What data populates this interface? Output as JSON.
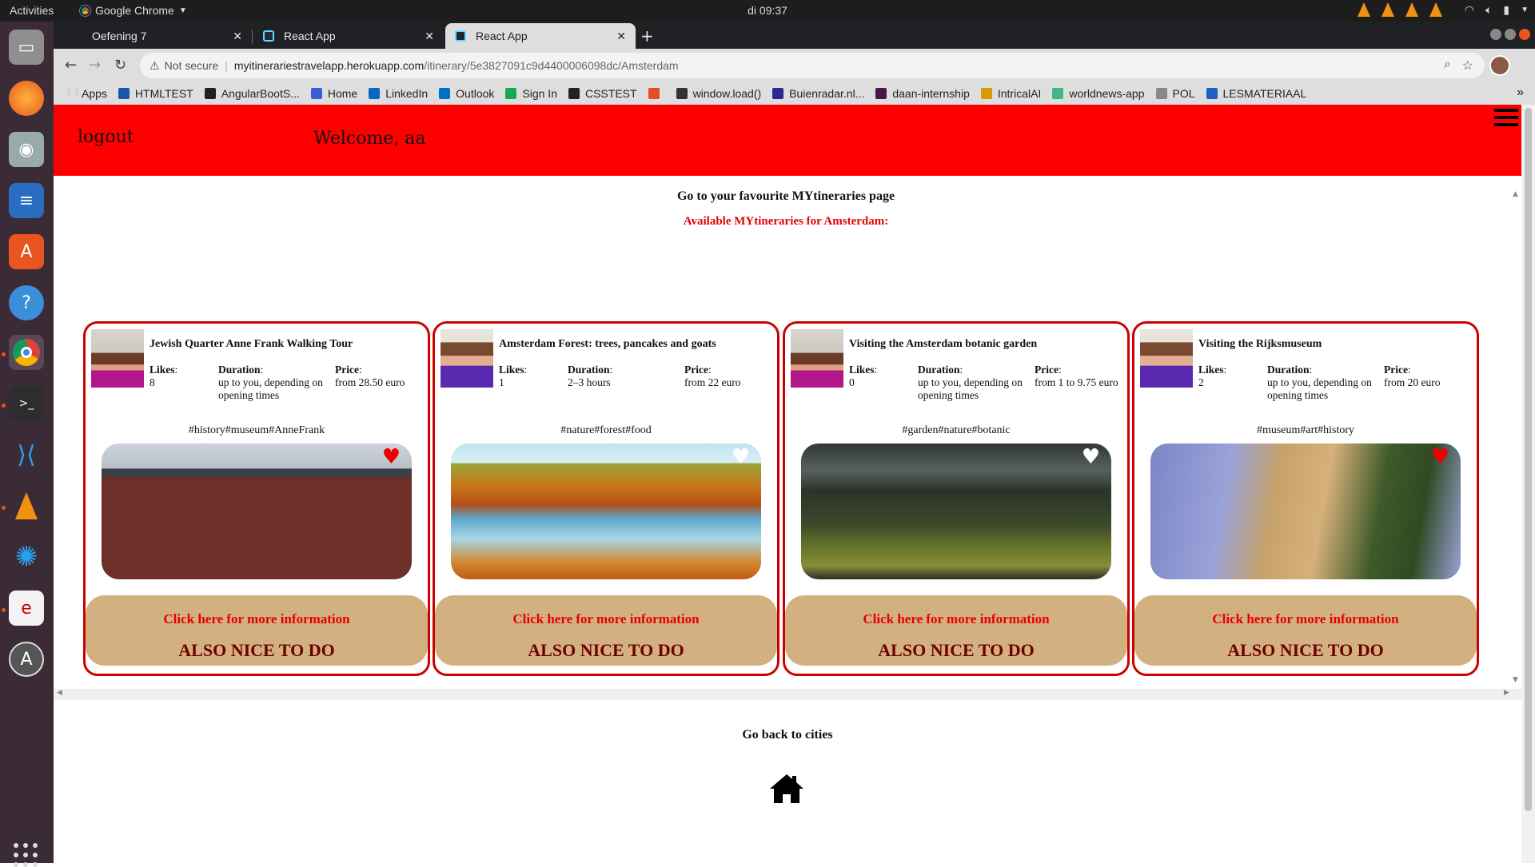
{
  "system": {
    "activities": "Activities",
    "app_name": "Google Chrome",
    "clock": "di 09:37"
  },
  "dock": {
    "icons": [
      "files-icon",
      "firefox-icon",
      "speaker-icon",
      "writer-icon",
      "software-center-icon",
      "help-icon",
      "chrome-icon",
      "terminal-icon",
      "vscode-icon",
      "vlc-icon",
      "settings-icon",
      "text-editor-icon",
      "updater-icon",
      "show-apps-icon"
    ]
  },
  "browser": {
    "tabs": [
      {
        "label": "Oefening 7",
        "active": false
      },
      {
        "label": "React App",
        "active": false
      },
      {
        "label": "React App",
        "active": true
      }
    ],
    "new_tab": "+",
    "security": "Not secure",
    "url_host": "myitinerariestravelapp.herokuapp.com",
    "url_path": "/itinerary/5e3827091c9d4400006098dc/Amsterdam",
    "bookmarks": [
      {
        "label": "Apps",
        "color": "#4285f4"
      },
      {
        "label": "HTMLTEST",
        "color": "#1a56a8"
      },
      {
        "label": "AngularBootS...",
        "color": "#222222"
      },
      {
        "label": "Home",
        "color": "#3b5bdb"
      },
      {
        "label": "LinkedIn",
        "color": "#0a66c2"
      },
      {
        "label": "Outlook",
        "color": "#0072c6"
      },
      {
        "label": "Sign In",
        "color": "#13aa52"
      },
      {
        "label": "CSSTEST",
        "color": "#222222"
      },
      {
        "label": "",
        "color": "#e34f26"
      },
      {
        "label": "window.load()",
        "color": "#333333"
      },
      {
        "label": "Buienradar.nl...",
        "color": "#2b2b8f"
      },
      {
        "label": "daan-internship",
        "color": "#4a154b"
      },
      {
        "label": "IntricalAI",
        "color": "#d49a00"
      },
      {
        "label": "worldnews-app",
        "color": "#41b883"
      },
      {
        "label": "POL",
        "color": "#888888"
      },
      {
        "label": "LESMATERIAAL",
        "color": "#1f5fbf"
      }
    ],
    "bookmarks_more": "»"
  },
  "header": {
    "logout": "logout",
    "welcome": "Welcome, aa"
  },
  "main": {
    "heading": "Go to your favourite MYtineraries page",
    "subheading": "Available MYtineraries for Amsterdam:",
    "cards": [
      {
        "title": "Jewish Quarter Anne Frank Walking Tour",
        "likes_label": "Likes",
        "likes": "8",
        "duration_label": "Duration",
        "duration": "up to you, depending on opening times",
        "price_label": "Price",
        "price": "from 28.50 euro",
        "tags": "#history#museum#AnneFrank",
        "favourite": true,
        "more": "Click here for more information",
        "nice": "ALSO NICE TO DO"
      },
      {
        "title": "Amsterdam Forest: trees, pancakes and goats",
        "likes_label": "Likes",
        "likes": "1",
        "duration_label": "Duration",
        "duration": "2–3 hours",
        "price_label": "Price",
        "price": "from 22 euro",
        "tags": "#nature#forest#food",
        "favourite": false,
        "more": "Click here for more information",
        "nice": "ALSO NICE TO DO"
      },
      {
        "title": "Visiting the Amsterdam botanic garden",
        "likes_label": "Likes",
        "likes": "0",
        "duration_label": "Duration",
        "duration": "up to you, depending on opening times",
        "price_label": "Price",
        "price": "from 1 to 9.75 euro",
        "tags": "#garden#nature#botanic",
        "favourite": false,
        "more": "Click here for more information",
        "nice": "ALSO NICE TO DO"
      },
      {
        "title": "Visiting the Rijksmuseum",
        "likes_label": "Likes",
        "likes": "2",
        "duration_label": "Duration",
        "duration": "up to you, depending on opening times",
        "price_label": "Price",
        "price": "from 20 euro",
        "tags": "#museum#art#history",
        "favourite": true,
        "more": "Click here for more information",
        "nice": "ALSO NICE TO DO"
      }
    ]
  },
  "footer": {
    "go_back": "Go back to cities",
    "home_icon": "home-icon"
  },
  "colors": {
    "header_bg": "#ff0000",
    "subheading": "#e60000",
    "card_border": "#cc0000",
    "cta_bg": "#d2b07f",
    "cta_nice": "#6e0000",
    "heart": "#ee0000"
  }
}
